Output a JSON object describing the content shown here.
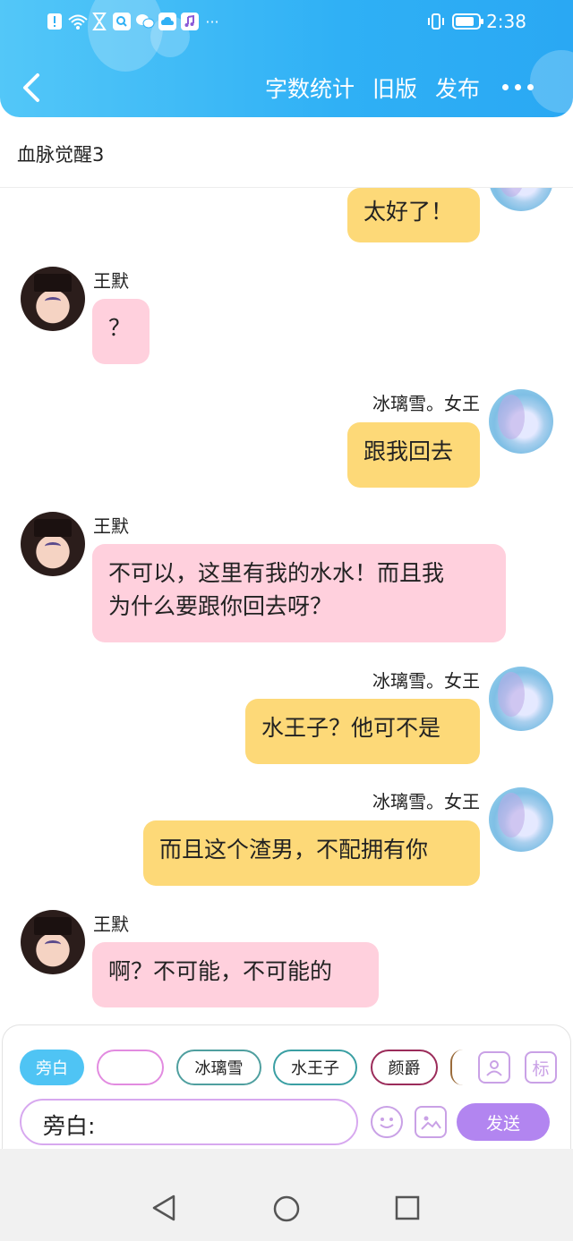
{
  "status_bar": {
    "time": "2:38",
    "icons": [
      "alert-icon",
      "wifi-icon",
      "hourglass-icon",
      "search-app-icon",
      "wechat-icon",
      "cloud-icon",
      "music-icon",
      "more-notifications-icon",
      "vibrate-icon",
      "battery-icon"
    ]
  },
  "header": {
    "actions": [
      "字数统计",
      "旧版",
      "发布"
    ]
  },
  "story_title": "血脉觉醒3",
  "messages": [
    {
      "side": "right",
      "speaker": "",
      "text": "太好了！"
    },
    {
      "side": "left",
      "speaker": "王默",
      "text": "？"
    },
    {
      "side": "right",
      "speaker": "冰璃雪。女王",
      "text": "跟我回去"
    },
    {
      "side": "left",
      "speaker": "王默",
      "text_line1": "不可以，这里有我的水水！而且我",
      "text_line2": "为什么要跟你回去呀？"
    },
    {
      "side": "right",
      "speaker": "冰璃雪。女王",
      "text": "水王子？他可不是"
    },
    {
      "side": "right",
      "speaker": "冰璃雪。女王",
      "text": "而且这个渣男，不配拥有你"
    },
    {
      "side": "left",
      "speaker": "王默",
      "text": "啊？不可能，不可能的"
    }
  ],
  "roles": {
    "narration": "旁白",
    "blank": "",
    "role2": "冰璃雪",
    "role3": "水王子",
    "role4": "颜爵",
    "role_icon": "person-card-icon",
    "tag_icon_label": "标"
  },
  "composer": {
    "input_value": "旁白:",
    "send_label": "发送"
  },
  "colors": {
    "header": "#2fb0f5",
    "left_bubble": "#ffd0dd",
    "right_bubble": "#fdd978",
    "send_button": "#b285f0"
  }
}
